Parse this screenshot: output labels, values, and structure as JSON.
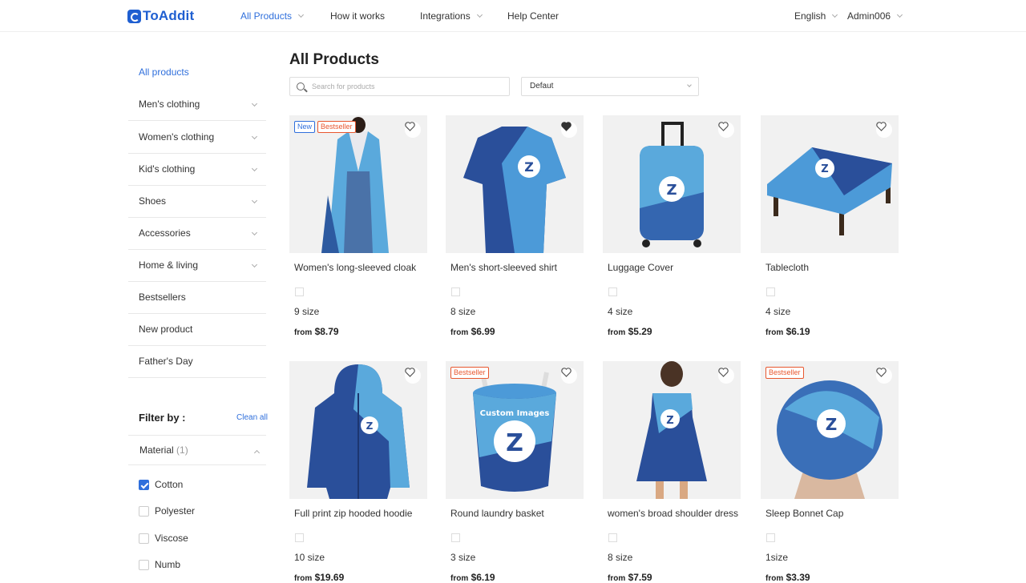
{
  "header": {
    "logo_text": "ToAddit",
    "nav": [
      "All Products",
      "How it works",
      "Integrations",
      "Help Center"
    ],
    "language": "English",
    "user": "Admin006"
  },
  "sidebar": {
    "all_label": "All products",
    "items": [
      "Men's clothing",
      "Women's clothing",
      "Kid's clothing",
      "Shoes",
      "Accessories",
      "Home & living",
      "Bestsellers",
      "New product",
      "Father's Day"
    ],
    "filter_title": "Filter by :",
    "clean_all": "Clean all",
    "material_label": "Material",
    "material_count": "(1)",
    "options": [
      {
        "label": "Cotton",
        "checked": true
      },
      {
        "label": "Polyester",
        "checked": false
      },
      {
        "label": "Viscose",
        "checked": false
      },
      {
        "label": "Numb",
        "checked": false
      }
    ]
  },
  "main": {
    "title": "All Products",
    "search_placeholder": "Search for products",
    "sort_value": "Defaut"
  },
  "badges": {
    "new": "New",
    "bestseller": "Bestseller"
  },
  "price_prefix": "from",
  "products": [
    {
      "name": "Women's long-sleeved cloak",
      "size": "9 size",
      "price": "$8.79"
    },
    {
      "name": "Men's short-sleeved shirt",
      "size": "8 size",
      "price": "$6.99"
    },
    {
      "name": "Luggage Cover",
      "size": "4 size",
      "price": "$5.29"
    },
    {
      "name": "Tablecloth",
      "size": "4 size",
      "price": "$6.19"
    },
    {
      "name": "Full print zip hooded hoodie",
      "size": "10 size",
      "price": "$19.69"
    },
    {
      "name": "Round laundry basket",
      "size": "3 size",
      "price": "$6.19"
    },
    {
      "name": "women's broad shoulder dress",
      "size": "8 size",
      "price": "$7.59"
    },
    {
      "name": "Sleep Bonnet Cap",
      "size": "1size",
      "price": "$3.39"
    }
  ],
  "image_caption": "Custom Images"
}
